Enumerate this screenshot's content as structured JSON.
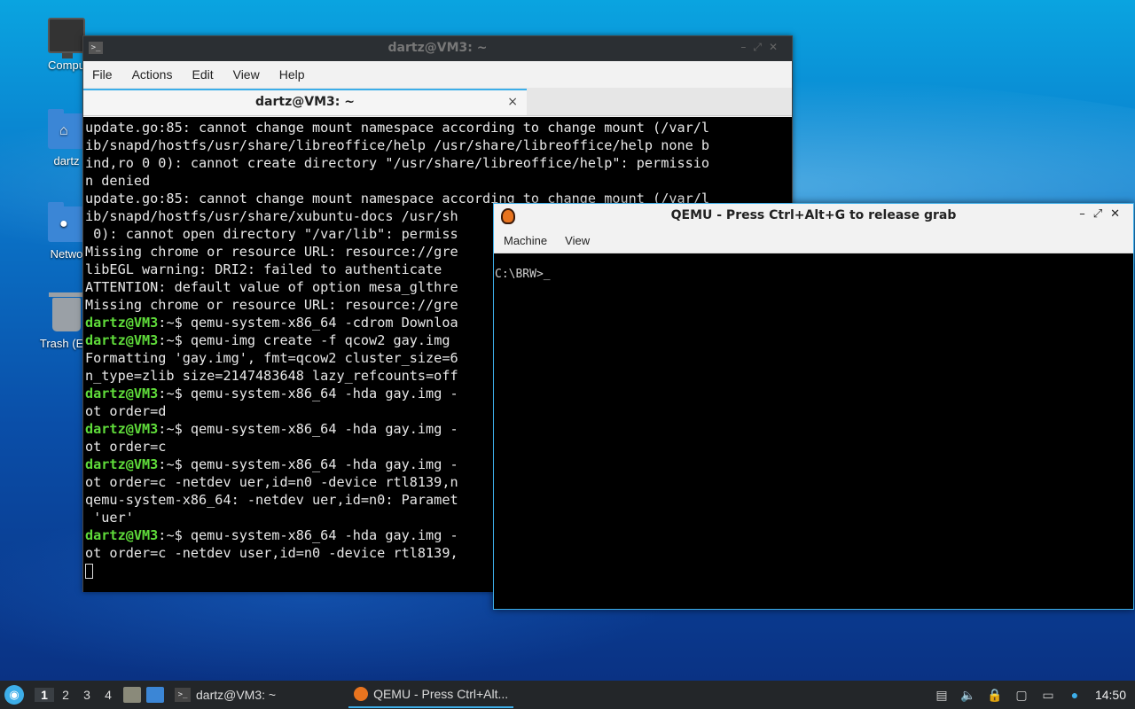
{
  "desktop": {
    "icons": [
      {
        "label": "Compu",
        "icon": "computer-icon"
      },
      {
        "label": "dartz",
        "icon": "home-folder-icon"
      },
      {
        "label": "Netwo",
        "icon": "network-folder-icon"
      },
      {
        "label": "Trash (Em",
        "icon": "trash-icon"
      }
    ]
  },
  "terminal": {
    "title": "dartz@VM3: ~",
    "menu": [
      "File",
      "Actions",
      "Edit",
      "View",
      "Help"
    ],
    "tab_label": "dartz@VM3: ~",
    "tab_close": "×",
    "lines": [
      {
        "prompt": "",
        "text": "update.go:85: cannot change mount namespace according to change mount (/var/l"
      },
      {
        "prompt": "",
        "text": "ib/snapd/hostfs/usr/share/libreoffice/help /usr/share/libreoffice/help none b"
      },
      {
        "prompt": "",
        "text": "ind,ro 0 0): cannot create directory \"/usr/share/libreoffice/help\": permissio"
      },
      {
        "prompt": "",
        "text": "n denied"
      },
      {
        "prompt": "",
        "text": "update.go:85: cannot change mount namespace according to change mount (/var/l"
      },
      {
        "prompt": "",
        "text": "ib/snapd/hostfs/usr/share/xubuntu-docs /usr/sh"
      },
      {
        "prompt": "",
        "text": " 0): cannot open directory \"/var/lib\": permiss"
      },
      {
        "prompt": "",
        "text": "Missing chrome or resource URL: resource://gre"
      },
      {
        "prompt": "",
        "text": "libEGL warning: DRI2: failed to authenticate"
      },
      {
        "prompt": "",
        "text": "ATTENTION: default value of option mesa_glthre"
      },
      {
        "prompt": "",
        "text": "Missing chrome or resource URL: resource://gre"
      },
      {
        "prompt": "dartz@VM3",
        "text": "~$ qemu-system-x86_64 -cdrom Downloa"
      },
      {
        "prompt": "dartz@VM3",
        "text": "~$ qemu-img create -f qcow2 gay.img"
      },
      {
        "prompt": "",
        "text": "Formatting 'gay.img', fmt=qcow2 cluster_size=6"
      },
      {
        "prompt": "",
        "text": "n_type=zlib size=2147483648 lazy_refcounts=off"
      },
      {
        "prompt": "dartz@VM3",
        "text": "~$ qemu-system-x86_64 -hda gay.img -"
      },
      {
        "prompt": "",
        "text": "ot order=d"
      },
      {
        "prompt": "dartz@VM3",
        "text": "~$ qemu-system-x86_64 -hda gay.img -"
      },
      {
        "prompt": "",
        "text": "ot order=c"
      },
      {
        "prompt": "dartz@VM3",
        "text": "~$ qemu-system-x86_64 -hda gay.img -"
      },
      {
        "prompt": "",
        "text": "ot order=c -netdev uer,id=n0 -device rtl8139,n"
      },
      {
        "prompt": "",
        "text": "qemu-system-x86_64: -netdev uer,id=n0: Paramet"
      },
      {
        "prompt": "",
        "text": " 'uer'"
      },
      {
        "prompt": "dartz@VM3",
        "text": "~$ qemu-system-x86_64 -hda gay.img -"
      },
      {
        "prompt": "",
        "text": "ot order=c -netdev user,id=n0 -device rtl8139,"
      }
    ]
  },
  "qemu": {
    "title": "QEMU - Press Ctrl+Alt+G to release grab",
    "menu": [
      "Machine",
      "View"
    ],
    "screen_text": "C:\\BRW>_"
  },
  "taskbar": {
    "workspaces": [
      "1",
      "2",
      "3",
      "4"
    ],
    "tasks": [
      {
        "label": "dartz@VM3: ~",
        "icon": "terminal-icon"
      },
      {
        "label": "QEMU - Press Ctrl+Alt...",
        "icon": "qemu-icon"
      }
    ],
    "clock": "14:50",
    "accent": "#3daee9"
  }
}
